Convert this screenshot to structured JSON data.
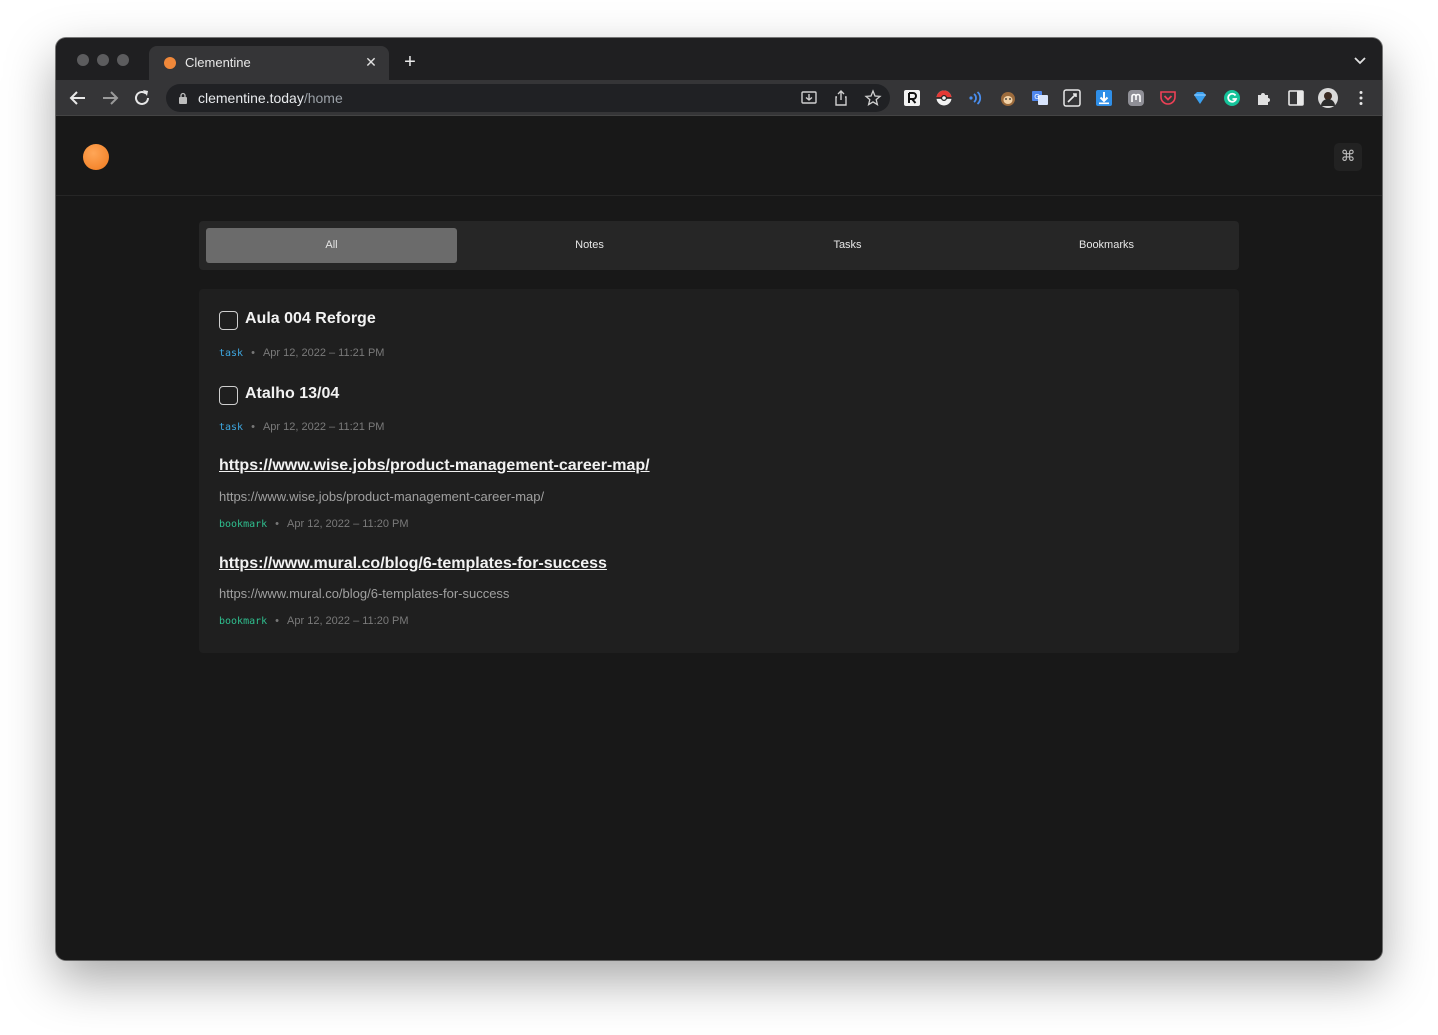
{
  "browser": {
    "tab_title": "Clementine",
    "tab_close": "✕",
    "new_tab": "+",
    "url_host": "clementine.today",
    "url_path": "/home"
  },
  "app": {
    "command_key": "⌘",
    "filter_tabs": [
      {
        "label": "All",
        "active": true
      },
      {
        "label": "Notes",
        "active": false
      },
      {
        "label": "Tasks",
        "active": false
      },
      {
        "label": "Bookmarks",
        "active": false
      }
    ],
    "items": [
      {
        "type": "task",
        "title": "Aula 004 Reforge",
        "tag": "task",
        "date": "Apr 12, 2022 – 11:21 PM"
      },
      {
        "type": "task",
        "title": "Atalho 13/04",
        "tag": "task",
        "date": "Apr 12, 2022 – 11:21 PM"
      },
      {
        "type": "bookmark",
        "title": "https://www.wise.jobs/product-management-career-map/",
        "url": "https://www.wise.jobs/product-management-career-map/",
        "tag": "bookmark",
        "date": "Apr 12, 2022 – 11:20 PM"
      },
      {
        "type": "bookmark",
        "title": "https://www.mural.co/blog/6-templates-for-success",
        "url": "https://www.mural.co/blog/6-templates-for-success",
        "tag": "bookmark",
        "date": "Apr 12, 2022 – 11:20 PM"
      }
    ]
  },
  "colors": {
    "accent": "#f0883a",
    "task_tag": "#3ea7e0",
    "bookmark_tag": "#2fbf8f"
  }
}
